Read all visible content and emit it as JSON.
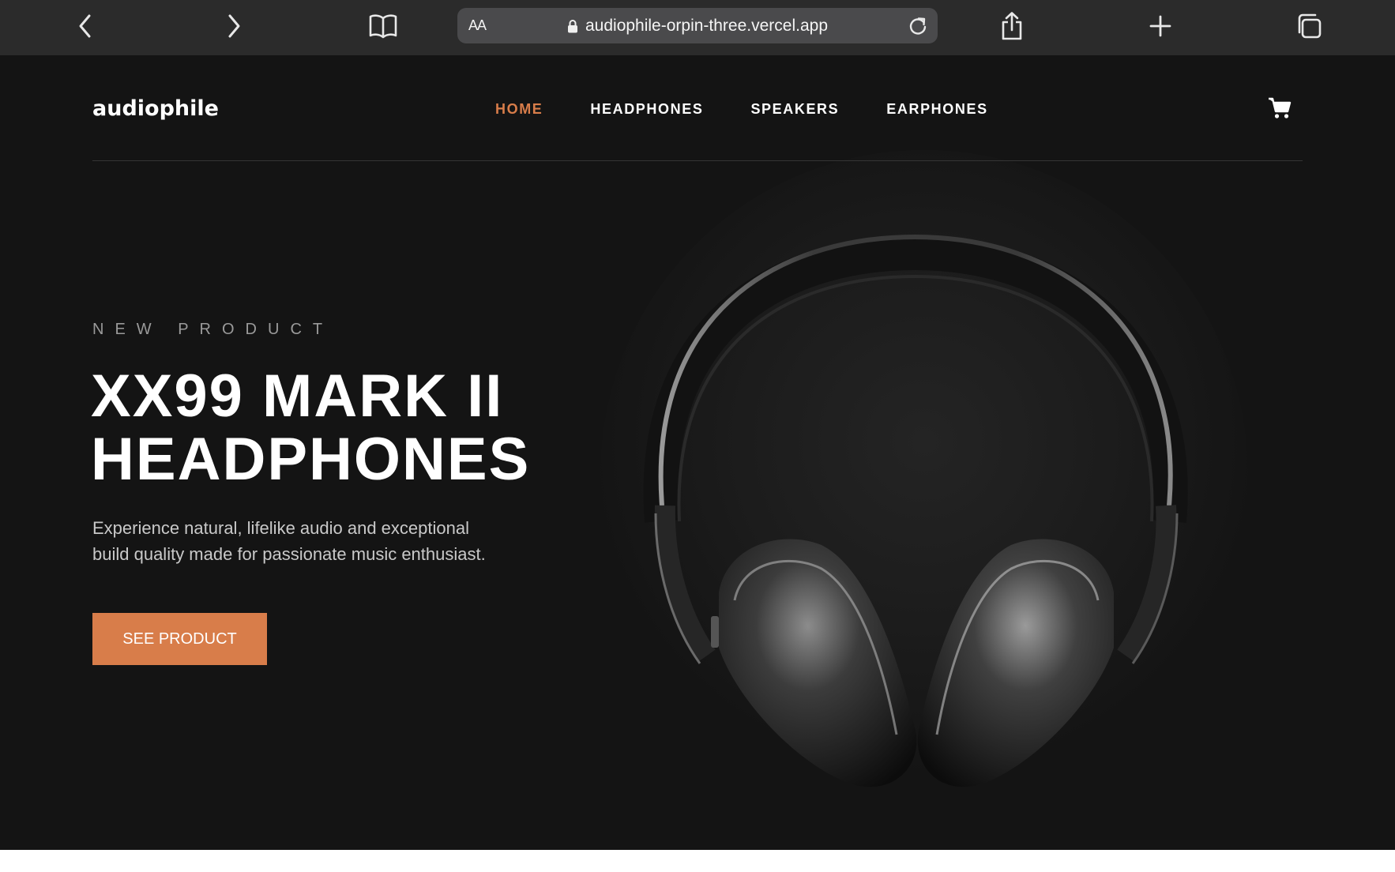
{
  "browser": {
    "font_size_label": "AA",
    "url": "audiophile-orpin-three.vercel.app",
    "icons": [
      "back-icon",
      "forward-icon",
      "bookmarks-icon",
      "lock-icon",
      "reload-icon",
      "share-icon",
      "new-tab-icon",
      "tabs-icon"
    ]
  },
  "site": {
    "logo": "audiophile",
    "nav": [
      {
        "label": "HOME",
        "active": true
      },
      {
        "label": "HEADPHONES",
        "active": false
      },
      {
        "label": "SPEAKERS",
        "active": false
      },
      {
        "label": "EARPHONES",
        "active": false
      }
    ],
    "cart_icon": "cart-icon",
    "accent_color": "#d87d4a",
    "background_color": "#141414"
  },
  "hero": {
    "overline": "NEW PRODUCT",
    "title_line1": "XX99 MARK II",
    "title_line2": "HEADPHONES",
    "description_line1": "Experience natural, lifelike audio and exceptional",
    "description_line2": "build quality made for passionate music enthusiast.",
    "cta_label": "SEE PRODUCT"
  }
}
